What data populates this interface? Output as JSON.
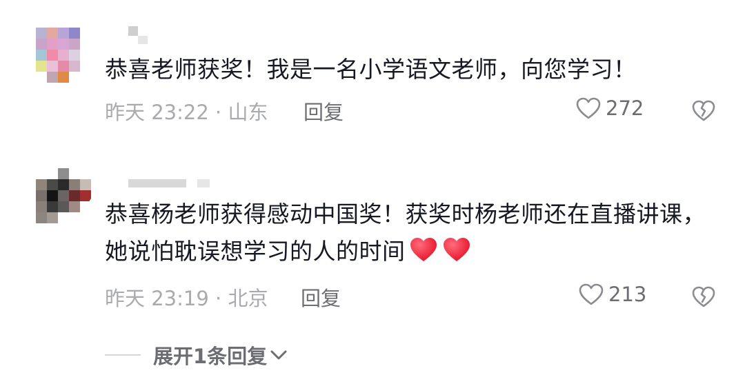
{
  "comments": [
    {
      "text": "恭喜老师获奖！我是一名小学语文老师，向您学习！",
      "time_location": "昨天 23:22 · 山东",
      "reply_label": "回复",
      "likes": "272"
    },
    {
      "text": "恭喜杨老师获得感动中国奖！获奖时杨老师还在直播讲课，她说怕耽误想学习的人的时间",
      "emojis": [
        "red-heart",
        "red-heart"
      ],
      "time_location": "昨天 23:19 · 北京",
      "reply_label": "回复",
      "likes": "213"
    }
  ],
  "expand_replies_label": "展开1条回复",
  "icons": {
    "like": "heart-outline-icon",
    "dislike": "broken-heart-icon",
    "expand": "chevron-down-icon"
  },
  "colors": {
    "text": "#161823",
    "meta": "#a9aaae",
    "action": "#6c6d72",
    "heart": "#ff2b43"
  }
}
